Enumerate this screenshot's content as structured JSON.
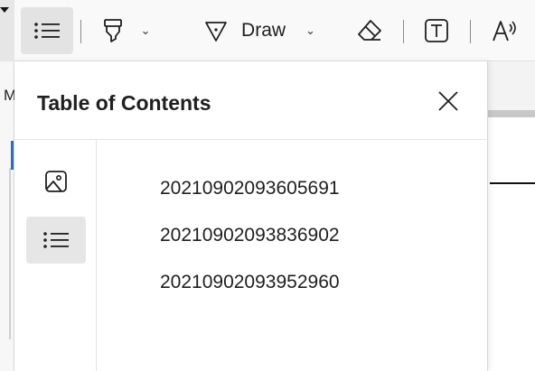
{
  "toolbar": {
    "draw_label": "Draw",
    "items": [
      {
        "name": "table-of-contents",
        "icon": "list-icon",
        "active": true
      },
      {
        "name": "highlight",
        "icon": "highlighter-icon"
      },
      {
        "name": "draw",
        "icon": "pen-icon"
      },
      {
        "name": "erase",
        "icon": "eraser-icon"
      },
      {
        "name": "add-text",
        "icon": "text-box-icon"
      },
      {
        "name": "read-aloud",
        "icon": "read-aloud-icon"
      }
    ]
  },
  "background": {
    "side_letter": "M"
  },
  "panel": {
    "title": "Table of Contents",
    "rail": [
      {
        "name": "thumbnails",
        "icon": "image-icon",
        "active": false
      },
      {
        "name": "outline",
        "icon": "list-icon",
        "active": true
      }
    ],
    "entries": [
      {
        "label": "20210902093605691"
      },
      {
        "label": "20210902093836902"
      },
      {
        "label": "20210902093952960"
      }
    ]
  },
  "colors": {
    "toolbar_bg": "#f9f9f9",
    "panel_bg": "#ffffff",
    "active_bg": "#e3e3e3",
    "accent_blue": "#2b6cc4"
  }
}
